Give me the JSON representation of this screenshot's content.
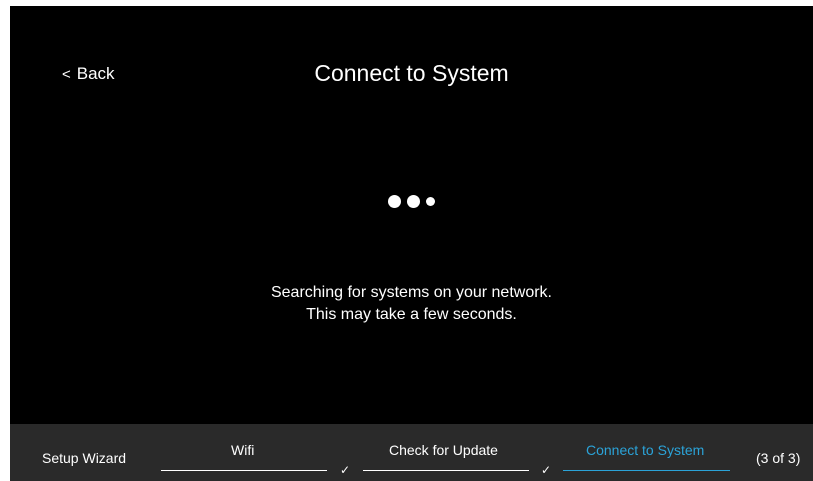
{
  "header": {
    "back_label": "Back",
    "title": "Connect to System"
  },
  "body": {
    "message_line1": "Searching for systems on your network.",
    "message_line2": "This may take a few seconds."
  },
  "footer": {
    "wizard_label": "Setup Wizard",
    "steps": [
      {
        "label": "Wifi",
        "status": "complete"
      },
      {
        "label": "Check for Update",
        "status": "complete"
      },
      {
        "label": "Connect to System",
        "status": "active"
      }
    ],
    "progress": "(3 of 3)"
  },
  "icons": {
    "back": "chevron-left-icon",
    "loading": "loading-dots-icon",
    "step_complete": "checkmark-icon"
  },
  "colors": {
    "background": "#000000",
    "footer_background": "#2a2a2a",
    "text": "#ffffff",
    "accent": "#2ba3d8"
  }
}
